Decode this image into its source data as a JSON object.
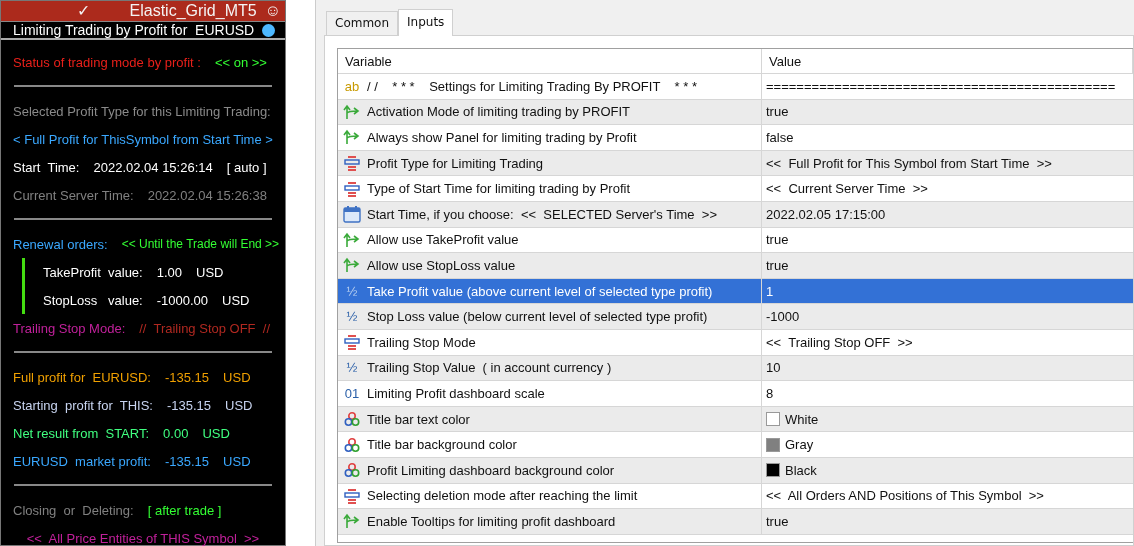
{
  "panel": {
    "title_bar": {
      "check": "✓",
      "title": "Elastic_Grid_MT5",
      "smiley": "☺"
    },
    "subtitle": {
      "text": "Limiting Trading by Profit for  EURUSD",
      "dot": {
        "color": "#4db8ff"
      }
    },
    "rows": [
      {
        "kind": "line",
        "parts": [
          {
            "text": "Status of trading mode by profit :",
            "color": "#e8201a"
          },
          {
            "text": "<< on >>",
            "color": "#33ff33"
          }
        ]
      },
      {
        "kind": "divider"
      },
      {
        "kind": "line",
        "parts": [
          {
            "text": "Selected Profit Type for this Limiting Trading:",
            "color": "#8a8a8a"
          }
        ]
      },
      {
        "kind": "line",
        "parts": [
          {
            "text": "< Full Profit for ThisSymbol from Start Time >",
            "color": "#3aa8ff"
          }
        ]
      },
      {
        "kind": "line",
        "parts": [
          {
            "text": "Start  Time:",
            "color": "#ffffff"
          },
          {
            "text": "2022.02.04 15:26:14",
            "color": "#ffffff"
          },
          {
            "text": "[ auto ]",
            "color": "#ffffff"
          }
        ]
      },
      {
        "kind": "line",
        "parts": [
          {
            "text": "Current Server Time:",
            "color": "#808080"
          },
          {
            "text": "2022.02.04 15:26:38",
            "color": "#808080"
          }
        ]
      },
      {
        "kind": "divider"
      },
      {
        "kind": "line",
        "parts": [
          {
            "text": "Renewal orders:",
            "color": "#3aa8ff"
          },
          {
            "text": "<< Until the Trade will End >>",
            "color": "#33ff33",
            "small": true
          }
        ]
      },
      {
        "kind": "group",
        "lines": [
          {
            "parts": [
              {
                "text": "TakeProfit  value:",
                "color": "#ffffff"
              },
              {
                "text": "1.00",
                "color": "#ffffff"
              },
              {
                "text": "USD",
                "color": "#ffffff"
              }
            ]
          },
          {
            "parts": [
              {
                "text": "StopLoss   value:",
                "color": "#ffffff"
              },
              {
                "text": "-1000.00",
                "color": "#ffffff"
              },
              {
                "text": "USD",
                "color": "#ffffff"
              }
            ]
          }
        ]
      },
      {
        "kind": "line",
        "parts": [
          {
            "text": "Trailing Stop Mode:",
            "color": "#c0209a"
          },
          {
            "text": "//  Trailing Stop OFF  //",
            "color": "#b02820"
          }
        ]
      },
      {
        "kind": "divider"
      },
      {
        "kind": "line",
        "parts": [
          {
            "text": "Full profit for  EURUSD:",
            "color": "#f0a000"
          },
          {
            "text": "-135.15",
            "color": "#f0a000"
          },
          {
            "text": "USD",
            "color": "#f0a000"
          }
        ]
      },
      {
        "kind": "line",
        "parts": [
          {
            "text": "Starting  profit for  THIS:",
            "color": "#c8d4f0"
          },
          {
            "text": "-135.15",
            "color": "#c8d4f0"
          },
          {
            "text": "USD",
            "color": "#c8d4f0"
          }
        ]
      },
      {
        "kind": "line",
        "parts": [
          {
            "text": "Net result from  START:",
            "color": "#40ff80"
          },
          {
            "text": "0.00",
            "color": "#40ff80"
          },
          {
            "text": "USD",
            "color": "#40ff80"
          }
        ]
      },
      {
        "kind": "line",
        "parts": [
          {
            "text": "EURUSD  market profit:",
            "color": "#3aa8ff"
          },
          {
            "text": "-135.15",
            "color": "#3aa8ff"
          },
          {
            "text": "USD",
            "color": "#3aa8ff"
          }
        ]
      },
      {
        "kind": "divider"
      },
      {
        "kind": "line",
        "parts": [
          {
            "text": "Closing  or  Deleting:",
            "color": "#808080"
          },
          {
            "text": "[ after trade ]",
            "color": "#33ff33"
          }
        ]
      },
      {
        "kind": "line",
        "parts": [
          {
            "text": "<<  All Price Entities of THIS Symbol  >>",
            "color": "#c0209a"
          }
        ],
        "centered": true
      }
    ]
  },
  "tabs": [
    {
      "label": "Common",
      "selected": false
    },
    {
      "label": "Inputs",
      "selected": true
    }
  ],
  "table": {
    "columns": [
      "Variable",
      "Value"
    ],
    "rows": [
      {
        "kind": "string",
        "glyph": "ab",
        "variable": "/ /    * * *    Settings for Limiting Trading By PROFIT    * * *",
        "value": "==============================================",
        "selected": false
      },
      {
        "kind": "bool",
        "variable": "Activation Mode of limiting trading by PROFIT",
        "value": "true",
        "selected": false
      },
      {
        "kind": "bool",
        "variable": "Always show Panel for limiting trading by Profit",
        "value": "false",
        "selected": false
      },
      {
        "kind": "enum",
        "variable": "Profit Type for Limiting Trading",
        "value": "<<  Full Profit for This Symbol from Start Time  >>",
        "selected": false
      },
      {
        "kind": "enum",
        "variable": "Type of Start Time for limiting trading by Profit",
        "value": "<<  Current Server Time  >>",
        "selected": false
      },
      {
        "kind": "date",
        "variable": "Start Time, if you choose:  <<  SELECTED Server's Time  >>",
        "value": "2022.02.05 17:15:00",
        "selected": false
      },
      {
        "kind": "bool",
        "variable": "Allow use TakeProfit value",
        "value": "true",
        "selected": false
      },
      {
        "kind": "bool",
        "variable": "Allow use StopLoss value",
        "value": "true",
        "selected": false
      },
      {
        "kind": "double",
        "glyph": "½",
        "variable": "Take Profit value (above current level of selected type profit)",
        "value": "1",
        "selected": true
      },
      {
        "kind": "double",
        "glyph": "½",
        "variable": "Stop Loss value (below current level of selected type profit)",
        "value": "-1000",
        "selected": false
      },
      {
        "kind": "enum",
        "variable": "Trailing Stop Mode",
        "value": "<<  Trailing Stop OFF  >>",
        "selected": false
      },
      {
        "kind": "double",
        "glyph": "½",
        "variable": "Trailing Stop Value  ( in account currency )",
        "value": "10",
        "selected": false
      },
      {
        "kind": "int",
        "glyph": "01",
        "variable": "Limiting Profit dashboard scale",
        "value": "8",
        "selected": false
      },
      {
        "kind": "color",
        "variable": "Title bar text color",
        "value": "White",
        "color": "#ffffff",
        "selected": false
      },
      {
        "kind": "color",
        "variable": "Title bar background color",
        "value": "Gray",
        "color": "#808080",
        "selected": false
      },
      {
        "kind": "color",
        "variable": "Profit Limiting dashboard background color",
        "value": "Black",
        "color": "#000000",
        "selected": false
      },
      {
        "kind": "enum",
        "variable": "Selecting deletion mode after reaching the limit",
        "value": "<<  All Orders AND Positions of This Symbol  >>",
        "selected": false
      },
      {
        "kind": "bool",
        "variable": "Enable Tooltips for limiting profit dashboard",
        "value": "true",
        "selected": false
      }
    ]
  }
}
